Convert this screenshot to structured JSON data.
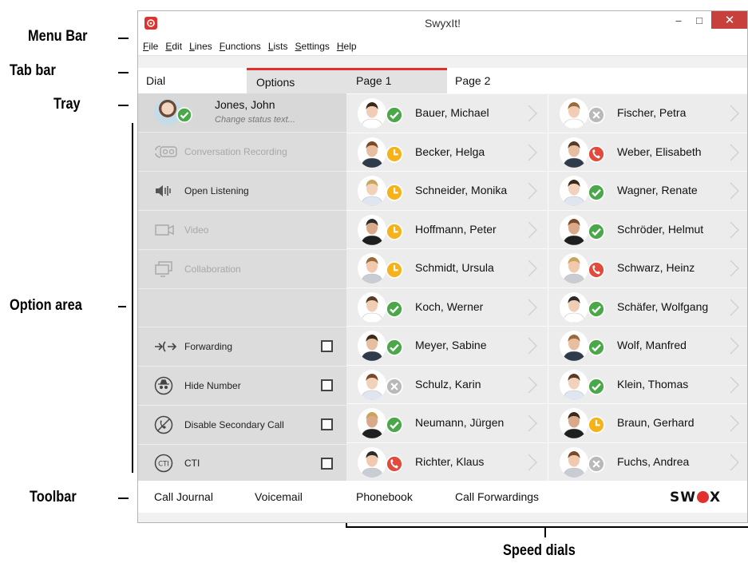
{
  "annotations": {
    "menu_bar": "Menu Bar",
    "tab_bar": "Tab bar",
    "tray": "Tray",
    "option_area": "Option area",
    "toolbar": "Toolbar",
    "speed_dials": "Speed dials"
  },
  "window": {
    "title": "SwyxIt!",
    "controls": {
      "minimize": "–",
      "maximize": "□",
      "close": "✕"
    }
  },
  "menu": [
    "File",
    "Edit",
    "Lines",
    "Functions",
    "Lists",
    "Settings",
    "Help"
  ],
  "tabs": [
    "Dial",
    "Options",
    "Page 1",
    "Page 2"
  ],
  "tray": {
    "name": "Jones, John",
    "status_text": "Change status text..."
  },
  "options": [
    {
      "label": "Conversation Recording",
      "icon": "recording-icon",
      "enabled": false,
      "checkbox": false
    },
    {
      "label": "Open Listening",
      "icon": "speaker-icon",
      "enabled": true,
      "checkbox": false
    },
    {
      "label": "Video",
      "icon": "video-icon",
      "enabled": false,
      "checkbox": false
    },
    {
      "label": "Collaboration",
      "icon": "collaboration-icon",
      "enabled": false,
      "checkbox": false
    },
    {
      "label": "Forwarding",
      "icon": "forwarding-icon",
      "enabled": true,
      "checkbox": true
    },
    {
      "label": "Hide Number",
      "icon": "incognito-icon",
      "enabled": true,
      "checkbox": true
    },
    {
      "label": "Disable Secondary Call",
      "icon": "disable-call-icon",
      "enabled": true,
      "checkbox": true
    },
    {
      "label": "CTI",
      "icon": "cti-icon",
      "enabled": true,
      "checkbox": true
    }
  ],
  "speed_dials": [
    [
      {
        "name": "Bauer, Michael",
        "status": "available"
      },
      {
        "name": "Becker, Helga",
        "status": "away"
      },
      {
        "name": "Schneider, Monika",
        "status": "away"
      },
      {
        "name": "Hoffmann, Peter",
        "status": "away"
      },
      {
        "name": "Schmidt, Ursula",
        "status": "away"
      },
      {
        "name": "Koch, Werner",
        "status": "available"
      },
      {
        "name": "Meyer, Sabine",
        "status": "available"
      },
      {
        "name": "Schulz, Karin",
        "status": "offline"
      },
      {
        "name": "Neumann, Jürgen",
        "status": "available"
      },
      {
        "name": "Richter, Klaus",
        "status": "on-call"
      }
    ],
    [
      {
        "name": "Fischer, Petra",
        "status": "offline"
      },
      {
        "name": "Weber, Elisabeth",
        "status": "on-call"
      },
      {
        "name": "Wagner, Renate",
        "status": "available"
      },
      {
        "name": "Schröder, Helmut",
        "status": "available"
      },
      {
        "name": "Schwarz, Heinz",
        "status": "on-call"
      },
      {
        "name": "Schäfer, Wolfgang",
        "status": "available"
      },
      {
        "name": "Wolf, Manfred",
        "status": "available"
      },
      {
        "name": "Klein, Thomas",
        "status": "available"
      },
      {
        "name": "Braun, Gerhard",
        "status": "away"
      },
      {
        "name": "Fuchs, Andrea",
        "status": "offline"
      }
    ]
  ],
  "toolbar": [
    "Call Journal",
    "Voicemail",
    "Phonebook",
    "Call Forwardings"
  ],
  "logo_text": [
    "SW",
    "X"
  ],
  "colors": {
    "accent": "#e0312f",
    "available": "#4aa84a",
    "away": "#f5b21a",
    "on-call": "#e24a3b",
    "offline": "#b9b9b9"
  }
}
